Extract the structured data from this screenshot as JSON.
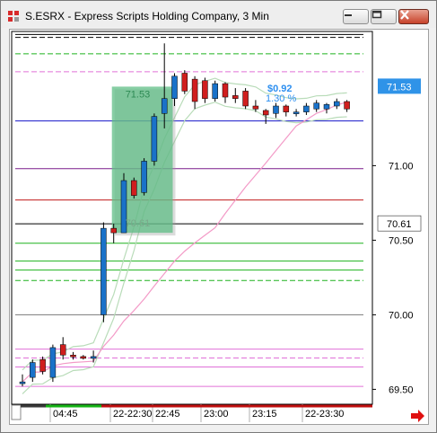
{
  "window": {
    "title": "S.ESRX - Express Scripts Holding Company, 3 Min",
    "buttons": {
      "minimize": "minimize-icon",
      "maximize": "maximize-icon",
      "close": "close-icon"
    }
  },
  "colors": {
    "up": "#1a72c9",
    "down": "#d01e1e",
    "box": "#5fbd86",
    "blue_line": "#1616c9",
    "red_line": "#c11a1a",
    "purple_line": "#7a1d8c",
    "green_line": "#1fb21f",
    "pink_line": "#e070d8",
    "gray_line": "#7a7a7a",
    "ma_pink": "#f39ac7",
    "band": "#b9dcb9",
    "label_blue": "#2d8ff0",
    "last_price_bg": "#2f93e8"
  },
  "chart": {
    "price_scale": {
      "ticks": [
        "71.00",
        "70.50",
        "70.00",
        "69.50"
      ],
      "last_price_label": "71.53",
      "ref_price_label": "70.61"
    },
    "time_axis": {
      "labels": [
        "04:45",
        "22-22:30",
        "22:45",
        "23:00",
        "23:15",
        "22-23:30"
      ]
    },
    "annotations": {
      "change": "$0.92",
      "change_pct": "1.30 %",
      "box_high": "71.53",
      "box_low": "70.61"
    },
    "scroll_arrow": "arrow-right-icon"
  },
  "chart_data": {
    "type": "candlestick",
    "title": "S.ESRX - Express Scripts Holding Company, 3 Min",
    "ylim": [
      69.4,
      71.9
    ],
    "candles": [
      {
        "o": 69.55,
        "h": 69.6,
        "l": 69.52,
        "c": 69.55
      },
      {
        "o": 69.58,
        "h": 69.7,
        "l": 69.55,
        "c": 69.68
      },
      {
        "o": 69.7,
        "h": 69.72,
        "l": 69.6,
        "c": 69.62
      },
      {
        "o": 69.58,
        "h": 69.8,
        "l": 69.55,
        "c": 69.78
      },
      {
        "o": 69.8,
        "h": 69.85,
        "l": 69.7,
        "c": 69.73
      },
      {
        "o": 69.73,
        "h": 69.75,
        "l": 69.7,
        "c": 69.72
      },
      {
        "o": 69.72,
        "h": 69.73,
        "l": 69.7,
        "c": 69.71
      },
      {
        "o": 69.72,
        "h": 69.76,
        "l": 69.68,
        "c": 69.72
      },
      {
        "o": 70.0,
        "h": 70.62,
        "l": 69.95,
        "c": 70.58
      },
      {
        "o": 70.58,
        "h": 70.61,
        "l": 70.48,
        "c": 70.55
      },
      {
        "o": 70.55,
        "h": 70.95,
        "l": 70.55,
        "c": 70.9
      },
      {
        "o": 70.9,
        "h": 70.92,
        "l": 70.78,
        "c": 70.8
      },
      {
        "o": 70.82,
        "h": 71.05,
        "l": 70.8,
        "c": 71.03
      },
      {
        "o": 71.03,
        "h": 71.35,
        "l": 71.0,
        "c": 71.33
      },
      {
        "o": 71.35,
        "h": 71.82,
        "l": 71.25,
        "c": 71.45
      },
      {
        "o": 71.45,
        "h": 71.62,
        "l": 71.4,
        "c": 71.6
      },
      {
        "o": 71.62,
        "h": 71.64,
        "l": 71.48,
        "c": 71.5
      },
      {
        "o": 71.58,
        "h": 71.6,
        "l": 71.38,
        "c": 71.43
      },
      {
        "o": 71.57,
        "h": 71.59,
        "l": 71.42,
        "c": 71.45
      },
      {
        "o": 71.45,
        "h": 71.57,
        "l": 71.43,
        "c": 71.55
      },
      {
        "o": 71.55,
        "h": 71.56,
        "l": 71.42,
        "c": 71.46
      },
      {
        "o": 71.47,
        "h": 71.52,
        "l": 71.42,
        "c": 71.45
      },
      {
        "o": 71.5,
        "h": 71.52,
        "l": 71.38,
        "c": 71.4
      },
      {
        "o": 71.4,
        "h": 71.44,
        "l": 71.36,
        "c": 71.38
      },
      {
        "o": 71.37,
        "h": 71.38,
        "l": 71.28,
        "c": 71.34
      },
      {
        "o": 71.35,
        "h": 71.42,
        "l": 71.32,
        "c": 71.4
      },
      {
        "o": 71.4,
        "h": 71.41,
        "l": 71.33,
        "c": 71.36
      },
      {
        "o": 71.35,
        "h": 71.38,
        "l": 71.33,
        "c": 71.36
      },
      {
        "o": 71.36,
        "h": 71.42,
        "l": 71.34,
        "c": 71.4
      },
      {
        "o": 71.38,
        "h": 71.44,
        "l": 71.36,
        "c": 71.42
      },
      {
        "o": 71.38,
        "h": 71.42,
        "l": 71.35,
        "c": 71.41
      },
      {
        "o": 71.4,
        "h": 71.45,
        "l": 71.38,
        "c": 71.43
      },
      {
        "o": 71.43,
        "h": 71.44,
        "l": 71.36,
        "c": 71.38
      }
    ],
    "hlines": [
      {
        "price": 71.3,
        "color": "#1616c9",
        "style": "solid"
      },
      {
        "price": 70.98,
        "color": "#7a1d8c",
        "style": "solid"
      },
      {
        "price": 70.77,
        "color": "#c11a1a",
        "style": "solid"
      },
      {
        "price": 70.61,
        "color": "#000000",
        "style": "solid"
      },
      {
        "price": 70.48,
        "color": "#1fb21f",
        "style": "solid"
      },
      {
        "price": 70.36,
        "color": "#1fb21f",
        "style": "solid"
      },
      {
        "price": 70.3,
        "color": "#1fb21f",
        "style": "solid"
      },
      {
        "price": 70.23,
        "color": "#1fb21f",
        "style": "dashed"
      },
      {
        "price": 70.0,
        "color": "#7a7a7a",
        "style": "solid"
      },
      {
        "price": 69.77,
        "color": "#e070d8",
        "style": "solid"
      },
      {
        "price": 69.71,
        "color": "#e070d8",
        "style": "dashed"
      },
      {
        "price": 69.65,
        "color": "#e070d8",
        "style": "solid"
      },
      {
        "price": 69.52,
        "color": "#e070d8",
        "style": "solid"
      },
      {
        "price": 71.75,
        "color": "#1fb21f",
        "style": "dashed"
      },
      {
        "price": 71.63,
        "color": "#e070d8",
        "style": "dashed"
      },
      {
        "price": 71.86,
        "color": "#000000",
        "style": "dashed"
      },
      {
        "price": 71.88,
        "color": "#000000",
        "style": "solid"
      }
    ]
  }
}
